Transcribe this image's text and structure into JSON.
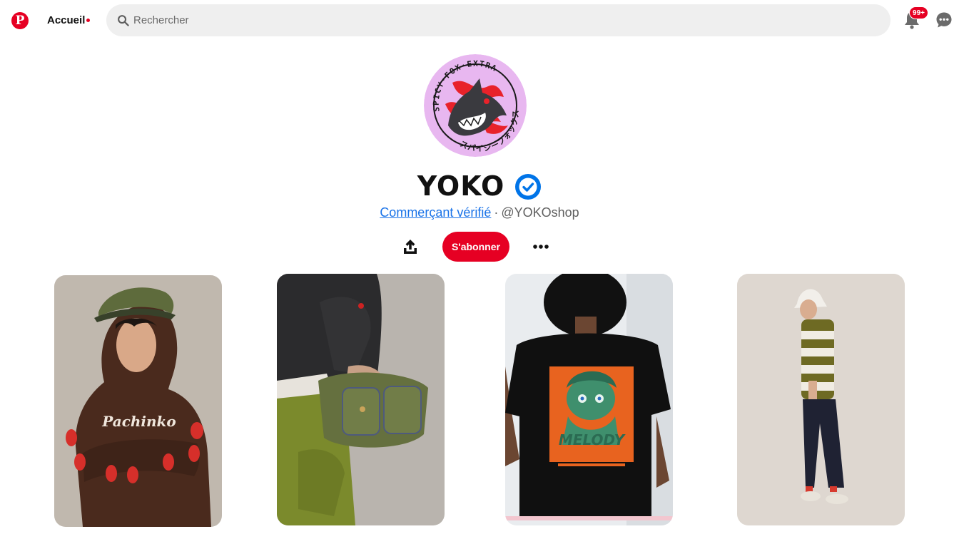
{
  "header": {
    "logo_letter": "P",
    "home_label": "Accueil",
    "search_placeholder": "Rechercher",
    "notification_badge": "99+"
  },
  "profile": {
    "name": "YOKO",
    "verified_label": "Commerçant vérifié",
    "separator": "·",
    "handle": "@YOKOshop",
    "follow_label": "S'abonner",
    "avatar_text_top": "SPICY·FOX·EXTRA",
    "avatar_text_bottom": "スパイシーフォックス"
  },
  "pins": [
    {
      "subject": "brown-hoodie",
      "print_text": "Pachinko"
    },
    {
      "subject": "olive-bag"
    },
    {
      "subject": "melody-tee",
      "print_text": "MELODY"
    },
    {
      "subject": "striped-tee"
    }
  ],
  "colors": {
    "accent": "#e60023",
    "verified_blue": "#0074e8",
    "link": "#1a73e8",
    "search_bg": "#efefef"
  },
  "icons": [
    "pinterest-logo-icon",
    "search-icon",
    "bell-icon",
    "chat-icon",
    "verified-check-icon",
    "share-icon",
    "more-dots-icon"
  ]
}
